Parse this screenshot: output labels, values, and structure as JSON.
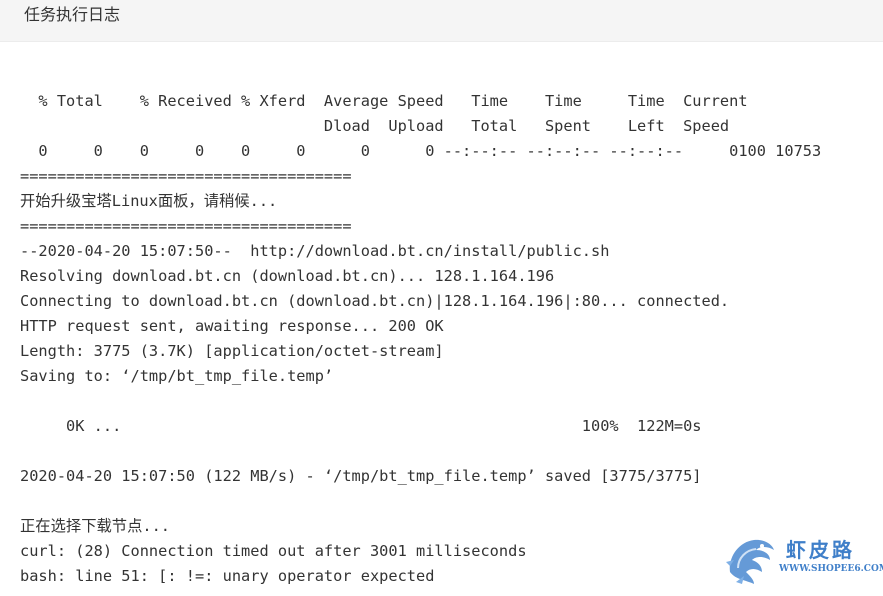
{
  "header": {
    "title": "任务执行日志"
  },
  "log": {
    "lines": [
      "  % Total    % Received % Xferd  Average Speed   Time    Time     Time  Current",
      "                                 Dload  Upload   Total   Spent    Left  Speed",
      "  0     0    0     0    0     0      0      0 --:--:-- --:--:-- --:--:--     0100 10753",
      "====================================",
      "开始升级宝塔Linux面板，请稍候...",
      "====================================",
      "--2020-04-20 15:07:50--  http://download.bt.cn/install/public.sh",
      "Resolving download.bt.cn (download.bt.cn)... 128.1.164.196",
      "Connecting to download.bt.cn (download.bt.cn)|128.1.164.196|:80... connected.",
      "HTTP request sent, awaiting response... 200 OK",
      "Length: 3775 (3.7K) [application/octet-stream]",
      "Saving to: ‘/tmp/bt_tmp_file.temp’",
      "",
      "     0K ...                                                  100%  122M=0s",
      "",
      "2020-04-20 15:07:50 (122 MB/s) - ‘/tmp/bt_tmp_file.temp’ saved [3775/3775]",
      "",
      "正在选择下载节点...",
      "curl: (28) Connection timed out after 3001 milliseconds",
      "bash: line 51: [: !=: unary operator expected"
    ]
  },
  "watermark": {
    "brand": "虾皮路",
    "url": "WWW.SHOPEE6.COM",
    "icon": "dragon-logo-icon",
    "color": "#3f7fc9"
  }
}
